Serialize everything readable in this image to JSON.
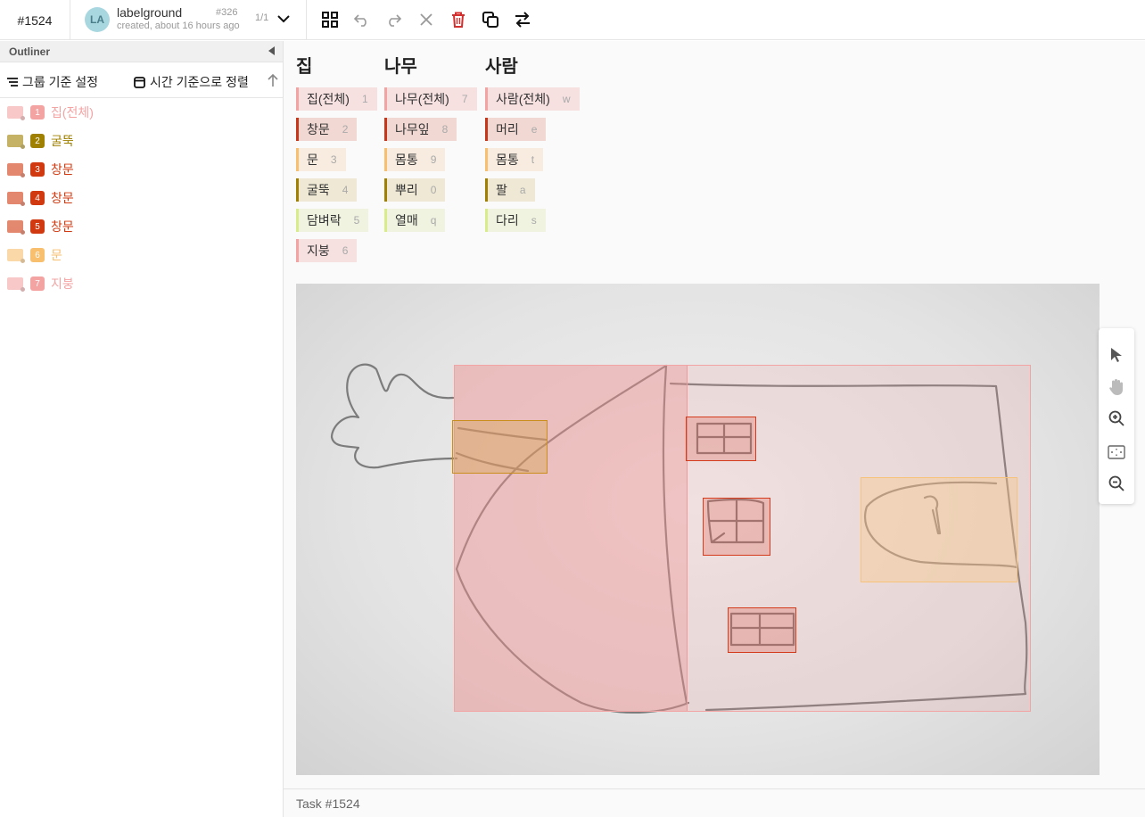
{
  "header": {
    "task_id": "#1524",
    "avatar_initials": "LA",
    "project_name": "labelground",
    "project_number": "#326",
    "created": "created, about 16 hours ago",
    "pager": "1/1"
  },
  "toolbar": {
    "icons": [
      "grid-icon",
      "undo-icon",
      "redo-icon",
      "close-icon",
      "delete-icon",
      "copy-icon",
      "swap-icon"
    ],
    "delete_color": "#d32f2f"
  },
  "sidebar": {
    "title": "Outliner",
    "group_by": "그룹 기준 설정",
    "sort_by_time": "시간 기준으로 정렬",
    "items": [
      {
        "num": "1",
        "label": "집(전체)",
        "color": "#f4a3a3"
      },
      {
        "num": "2",
        "label": "굴뚝",
        "color": "#a08000"
      },
      {
        "num": "3",
        "label": "창문",
        "color": "#d13a10"
      },
      {
        "num": "4",
        "label": "창문",
        "color": "#d13a10"
      },
      {
        "num": "5",
        "label": "창문",
        "color": "#d13a10"
      },
      {
        "num": "6",
        "label": "문",
        "color": "#f7bf6e"
      },
      {
        "num": "7",
        "label": "지붕",
        "color": "#f4a3a3"
      }
    ]
  },
  "labels": {
    "columns": [
      {
        "title": "집",
        "tags": [
          {
            "name": "집(전체)",
            "key": "1",
            "color": "#f4a3a3",
            "bg": "#f6e0e0"
          },
          {
            "name": "창문",
            "key": "2",
            "color": "#c8361a",
            "bg": "#f1d8d3"
          },
          {
            "name": "문",
            "key": "3",
            "color": "#f7bf6e",
            "bg": "#f7ecdf"
          },
          {
            "name": "굴뚝",
            "key": "4",
            "color": "#a08000",
            "bg": "#eee8d4"
          },
          {
            "name": "담벼락",
            "key": "5",
            "color": "#d8ec8a",
            "bg": "#eff3e0"
          },
          {
            "name": "지붕",
            "key": "6",
            "color": "#f4a3a3",
            "bg": "#f6e0e0"
          }
        ]
      },
      {
        "title": "나무",
        "tags": [
          {
            "name": "나무(전체)",
            "key": "7",
            "color": "#f4a3a3",
            "bg": "#f6e0e0"
          },
          {
            "name": "나무잎",
            "key": "8",
            "color": "#c8361a",
            "bg": "#f1d8d3"
          },
          {
            "name": "몸통",
            "key": "9",
            "color": "#f7bf6e",
            "bg": "#f7ecdf"
          },
          {
            "name": "뿌리",
            "key": "0",
            "color": "#a08000",
            "bg": "#eee8d4"
          },
          {
            "name": "열매",
            "key": "q",
            "color": "#d8ec8a",
            "bg": "#eff3e0"
          }
        ]
      },
      {
        "title": "사람",
        "tags": [
          {
            "name": "사람(전체)",
            "key": "w",
            "color": "#f4a3a3",
            "bg": "#f6e0e0"
          },
          {
            "name": "머리",
            "key": "e",
            "color": "#c8361a",
            "bg": "#f1d8d3"
          },
          {
            "name": "몸통",
            "key": "t",
            "color": "#f7bf6e",
            "bg": "#f7ecdf"
          },
          {
            "name": "팔",
            "key": "a",
            "color": "#a08000",
            "bg": "#eee8d4"
          },
          {
            "name": "다리",
            "key": "s",
            "color": "#d8ec8a",
            "bg": "#eff3e0"
          }
        ]
      }
    ]
  },
  "zoom_tools": [
    "pointer-icon",
    "hand-icon",
    "zoom-in-icon",
    "fit-screen-icon",
    "zoom-out-icon"
  ],
  "footer": {
    "task": "Task #1524"
  }
}
